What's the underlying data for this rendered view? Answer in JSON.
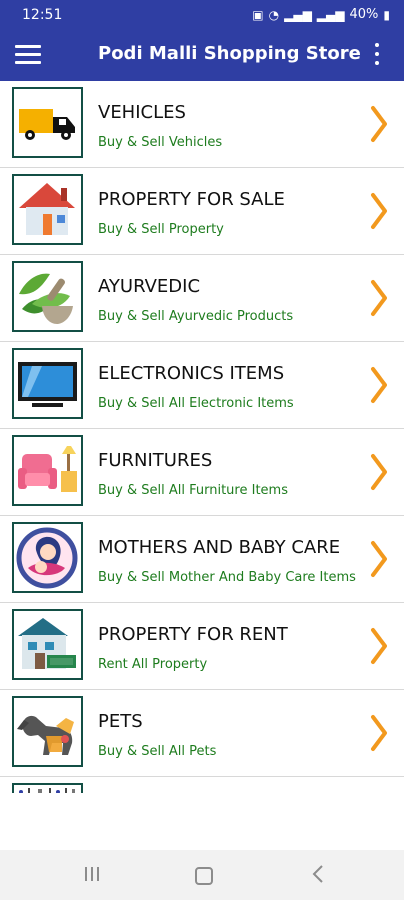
{
  "status_bar": {
    "time": "12:51",
    "battery": "40%",
    "icons": [
      "photo-icon",
      "wifi-icon",
      "signal-icon",
      "signal-icon",
      "battery-icon"
    ]
  },
  "app_bar": {
    "title": "Podi Malli Shopping Store",
    "menu_icon": "menu-icon",
    "overflow_icon": "more-vertical-icon"
  },
  "categories": [
    {
      "title": "VEHICLES",
      "subtitle": "Buy & Sell Vehicles",
      "icon": "truck-icon"
    },
    {
      "title": "PROPERTY FOR SALE",
      "subtitle": "Buy & Sell Property",
      "icon": "house-icon"
    },
    {
      "title": "AYURVEDIC",
      "subtitle": "Buy & Sell Ayurvedic Products",
      "icon": "mortar-leaf-icon"
    },
    {
      "title": "ELECTRONICS ITEMS",
      "subtitle": "Buy & Sell All Electronic Items",
      "icon": "television-icon"
    },
    {
      "title": "FURNITURES",
      "subtitle": "Buy & Sell All Furniture  Items",
      "icon": "armchair-icon"
    },
    {
      "title": "MOTHERS AND BABY CARE",
      "subtitle": "Buy & Sell Mother And Baby Care Items",
      "icon": "mother-baby-icon"
    },
    {
      "title": " PROPERTY FOR RENT",
      "subtitle": "Rent All  Property",
      "icon": "rent-house-icon"
    },
    {
      "title": "PETS",
      "subtitle": "Buy & Sell All Pets",
      "icon": "pets-icon"
    }
  ],
  "colors": {
    "primary": "#2f3ea3",
    "accent": "#f2991e",
    "subtitle": "#1e7c1e",
    "border": "#134f45"
  },
  "nav_bar": {
    "recent_icon": "recent-apps-icon",
    "home_icon": "home-icon",
    "back_icon": "back-icon"
  }
}
